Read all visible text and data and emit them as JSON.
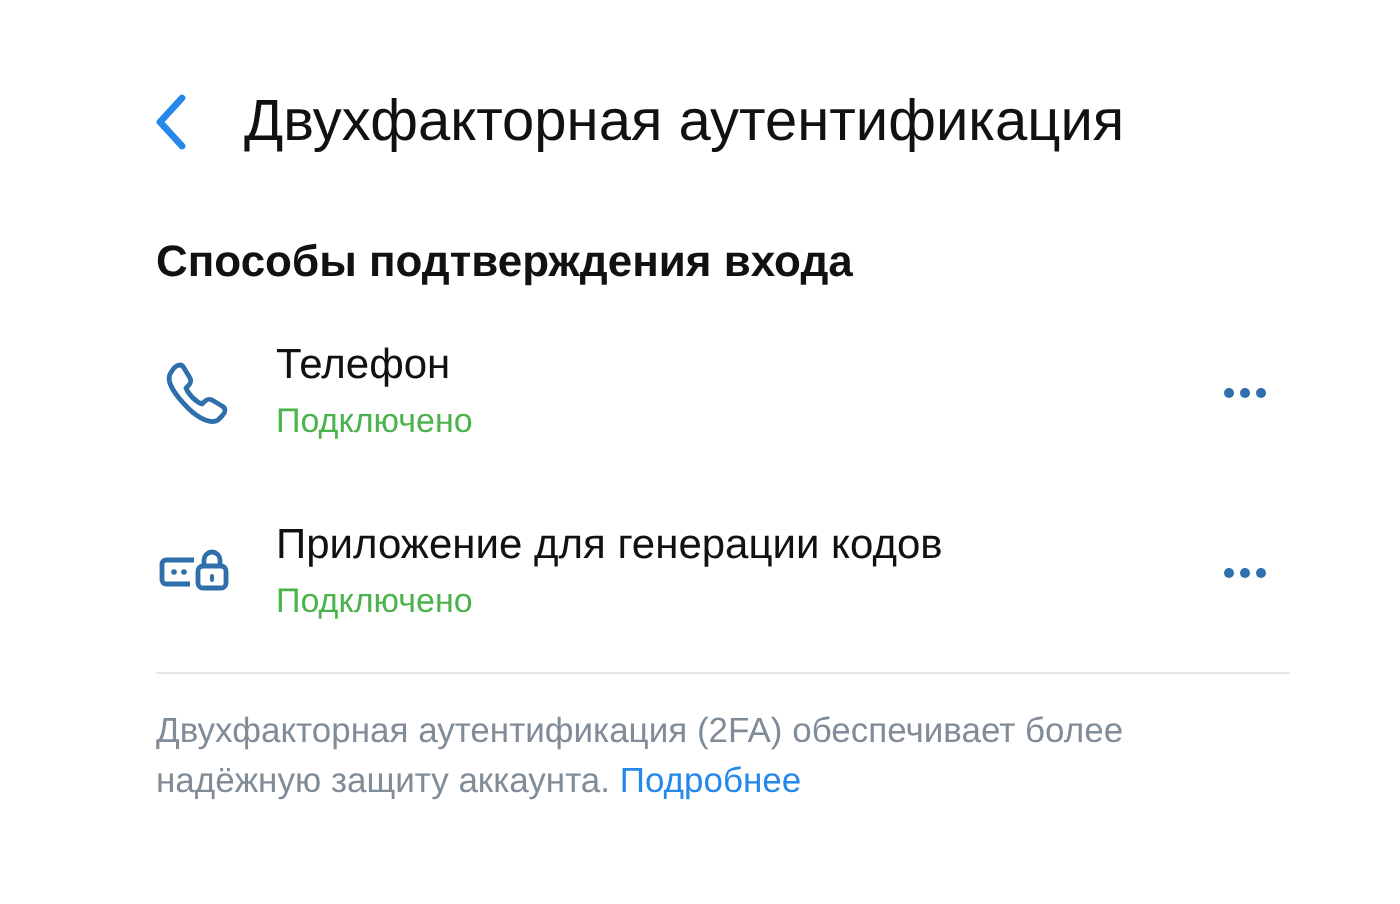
{
  "header": {
    "title": "Двухфакторная аутентификация"
  },
  "section": {
    "title": "Способы подтверждения входа"
  },
  "methods": [
    {
      "kind": "phone",
      "name": "Телефон",
      "status": "Подключено"
    },
    {
      "kind": "app",
      "name": "Приложение для генерации кодов",
      "status": "Подключено"
    }
  ],
  "footer": {
    "text": "Двухфакторная аутентификация (2FA) обеспечивает более надёжную защиту аккаунта.",
    "link": "Подробнее"
  }
}
